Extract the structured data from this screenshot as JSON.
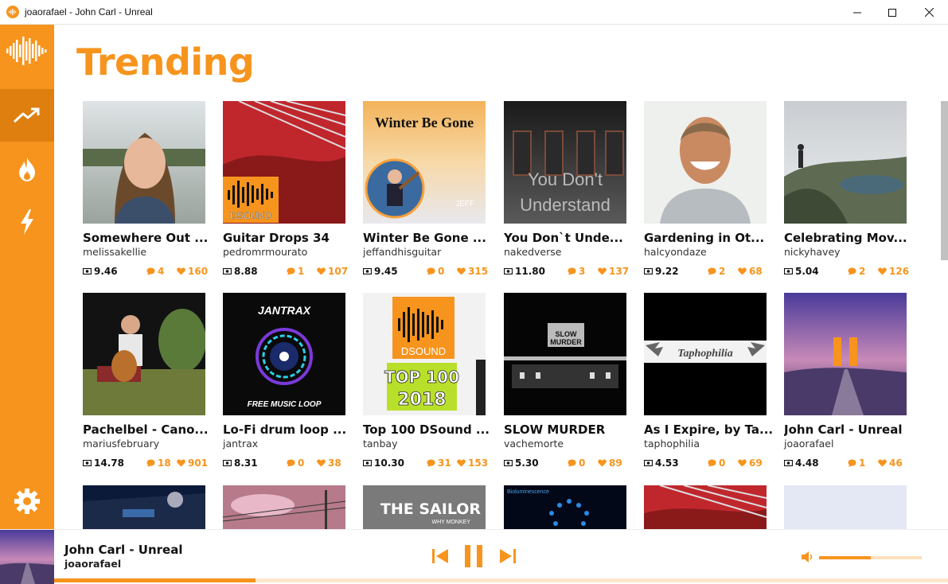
{
  "window": {
    "title": "joaorafael - John Carl - Unreal",
    "controls": [
      "minimize-icon",
      "maximize-icon",
      "close-icon"
    ]
  },
  "sidebar": {
    "logo_icon": "waveform-logo-icon",
    "items": [
      {
        "name": "trending",
        "icon": "trending-icon",
        "active": true
      },
      {
        "name": "hot",
        "icon": "flame-icon",
        "active": false
      },
      {
        "name": "new",
        "icon": "lightning-icon",
        "active": false
      }
    ],
    "settings_icon": "gear-icon"
  },
  "main": {
    "title": "Trending",
    "cards": [
      {
        "title": "Somewhere Out ...",
        "user": "melissakellie",
        "views": "9.46",
        "comments": "4",
        "likes": "160"
      },
      {
        "title": "Guitar Drops 34",
        "user": "pedromrmourato",
        "views": "8.88",
        "comments": "1",
        "likes": "107"
      },
      {
        "title": "Winter Be Gone ...",
        "user": "jeffandhisguitar",
        "views": "9.45",
        "comments": "0",
        "likes": "315"
      },
      {
        "title": "You Don`t Unde...",
        "user": "nakedverse",
        "views": "11.80",
        "comments": "3",
        "likes": "137"
      },
      {
        "title": "Gardening in Ot...",
        "user": "halcyondaze",
        "views": "9.22",
        "comments": "2",
        "likes": "68"
      },
      {
        "title": "Celebrating Mov...",
        "user": "nickyhavey",
        "views": "5.04",
        "comments": "2",
        "likes": "126"
      },
      {
        "title": "Pachelbel - Cano...",
        "user": "mariusfebruary",
        "views": "14.78",
        "comments": "18",
        "likes": "901"
      },
      {
        "title": "Lo-Fi drum loop ...",
        "user": "jantrax",
        "views": "8.31",
        "comments": "0",
        "likes": "38"
      },
      {
        "title": "Top 100 DSound ...",
        "user": "tanbay",
        "views": "10.30",
        "comments": "31",
        "likes": "153"
      },
      {
        "title": "SLOW MURDER",
        "user": "vachemorte",
        "views": "5.30",
        "comments": "0",
        "likes": "89"
      },
      {
        "title": "As I Expire, by Ta...",
        "user": "taphophilia",
        "views": "4.53",
        "comments": "0",
        "likes": "69"
      },
      {
        "title": "John Carl - Unreal",
        "user": "joaorafael",
        "views": "4.48",
        "comments": "1",
        "likes": "46"
      }
    ],
    "art_text": {
      "dsound": "DSOUND",
      "winter": "Winter Be Gone",
      "jeff": "JEFF",
      "youdont1": "You Don't",
      "youdont2": "Understand",
      "jantrax": "JANTRAX",
      "freeloop": "FREE MUSIC LOOP",
      "top100": "TOP 100",
      "year": "2018",
      "slow": "SLOW",
      "murder": "MURDER",
      "taphophilia": "Taphophilia",
      "sailor": "THE SAILOR",
      "whymonkey": "WHY MONKEY",
      "biolum": "Bioluminescence"
    }
  },
  "player": {
    "title": "John Carl - Unreal",
    "artist": "joaorafael",
    "volume": 0.5,
    "progress": 0.225
  },
  "colors": {
    "accent": "#f7941d",
    "accent_dark": "#de7f0f",
    "accent_light": "#fde7cb"
  }
}
